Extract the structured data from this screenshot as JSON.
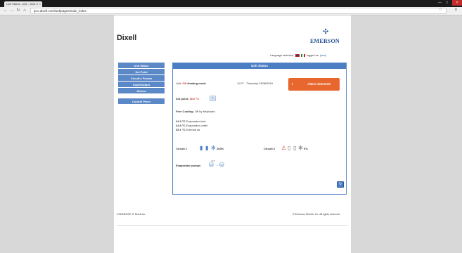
{
  "browser": {
    "tab_title": "Unit Status - Win - Dixit X",
    "tab_close": "×",
    "url": "ipro.dixell.com/webpages/main_index",
    "star": "☆",
    "menu": "≡",
    "min": "—",
    "max": "□",
    "close": "×"
  },
  "header": {
    "logo_left": "Dixell",
    "logo_right": "EMERSON",
    "logo_right_icon": "✣",
    "language_label": "Language selection:",
    "logged_label": "logged as:",
    "user": "[user]"
  },
  "sidebar": {
    "items": [
      {
        "label": "Unit Status"
      },
      {
        "label": "Set Point"
      },
      {
        "label": "Circuit's Probes"
      },
      {
        "label": "Input/Output"
      },
      {
        "label": "Alarms"
      }
    ],
    "control_panel": "Control Panel"
  },
  "panel": {
    "title": "Unit Status",
    "unit_label": "Unit:",
    "unit_value": "ON",
    "mode": "Heating mode",
    "datetime": "11:07 - Thursday 23/08/2019",
    "alarm_icon": "×",
    "alarm_label": "Alarm detected",
    "setpoint_label": "Set point:",
    "setpoint_value": "30.0 °C",
    "free_cooling_label": "Free Cooling:",
    "free_cooling_value": "Off by Keyboard",
    "temps": [
      {
        "value": "24.9 °C",
        "label": "Evaporator inlet"
      },
      {
        "value": "24.8 °C",
        "label": "Evaporator outlet"
      },
      {
        "value": "25.1 °C",
        "label": "External air"
      }
    ],
    "circuit1_label": "Circuit 1",
    "circuit1_pct": "100%",
    "circuit2_label": "Circuit 2",
    "circuit2_pct": "0%",
    "pumps_label": "Evaporator pumps",
    "pumps_value": "OFF"
  },
  "footer": {
    "left": "CONNESSO IT Dixell Inc.",
    "right": "© Emerson Electric Co. All rights reserved"
  }
}
